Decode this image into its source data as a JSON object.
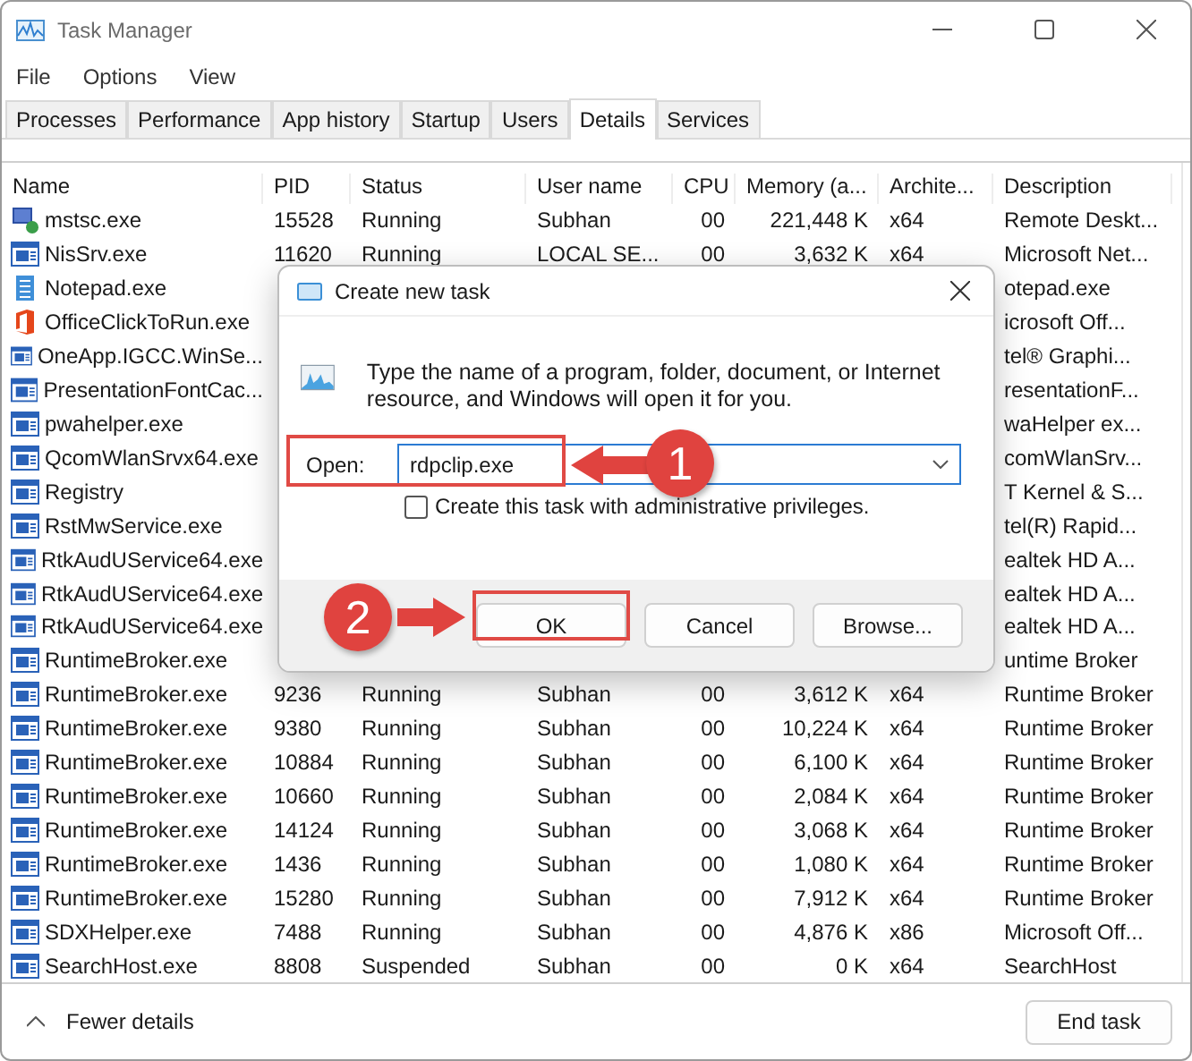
{
  "window": {
    "title": "Task Manager"
  },
  "menu": [
    "File",
    "Options",
    "View"
  ],
  "tabs": [
    {
      "label": "Processes",
      "selected": false
    },
    {
      "label": "Performance",
      "selected": false
    },
    {
      "label": "App history",
      "selected": false
    },
    {
      "label": "Startup",
      "selected": false
    },
    {
      "label": "Users",
      "selected": false
    },
    {
      "label": "Details",
      "selected": true
    },
    {
      "label": "Services",
      "selected": false
    }
  ],
  "table": {
    "columns": [
      "Name",
      "PID",
      "Status",
      "User name",
      "CPU",
      "Memory (a...",
      "Archite...",
      "Description"
    ],
    "rows": [
      {
        "kind": "remote",
        "name": "mstsc.exe",
        "pid": "15528",
        "status": "Running",
        "user": "Subhan",
        "cpu": "00",
        "memory": "221,448 K",
        "arch": "x64",
        "description": "Remote Deskt..."
      },
      {
        "kind": "app",
        "name": "NisSrv.exe",
        "pid": "11620",
        "status": "Running",
        "user": "LOCAL SE...",
        "cpu": "00",
        "memory": "3,632 K",
        "arch": "x64",
        "description": "Microsoft Net..."
      },
      {
        "kind": "notepad",
        "name": "Notepad.exe",
        "description": "otepad.exe"
      },
      {
        "kind": "office",
        "name": "OfficeClickToRun.exe",
        "description": "icrosoft Off..."
      },
      {
        "kind": "app",
        "name": "OneApp.IGCC.WinSe...",
        "description": "tel® Graphi..."
      },
      {
        "kind": "app",
        "name": "PresentationFontCac...",
        "description": "resentationF..."
      },
      {
        "kind": "app",
        "name": "pwahelper.exe",
        "description": "waHelper ex..."
      },
      {
        "kind": "app",
        "name": "QcomWlanSrvx64.exe",
        "description": "comWlanSrv..."
      },
      {
        "kind": "app",
        "name": "Registry",
        "description": "T Kernel & S..."
      },
      {
        "kind": "app",
        "name": "RstMwService.exe",
        "description": "tel(R) Rapid..."
      },
      {
        "kind": "app",
        "name": "RtkAudUService64.exe",
        "description": "ealtek HD A..."
      },
      {
        "kind": "app",
        "name": "RtkAudUService64.exe",
        "description": "ealtek HD A..."
      },
      {
        "kind": "app",
        "name": "RtkAudUService64.exe",
        "description": "ealtek HD A..."
      },
      {
        "kind": "app",
        "name": "RuntimeBroker.exe",
        "description": "untime Broker"
      },
      {
        "kind": "app",
        "name": "RuntimeBroker.exe",
        "pid": "9236",
        "status": "Running",
        "user": "Subhan",
        "cpu": "00",
        "memory": "3,612 K",
        "arch": "x64",
        "description": "Runtime Broker"
      },
      {
        "kind": "app",
        "name": "RuntimeBroker.exe",
        "pid": "9380",
        "status": "Running",
        "user": "Subhan",
        "cpu": "00",
        "memory": "10,224 K",
        "arch": "x64",
        "description": "Runtime Broker"
      },
      {
        "kind": "app",
        "name": "RuntimeBroker.exe",
        "pid": "10884",
        "status": "Running",
        "user": "Subhan",
        "cpu": "00",
        "memory": "6,100 K",
        "arch": "x64",
        "description": "Runtime Broker"
      },
      {
        "kind": "app",
        "name": "RuntimeBroker.exe",
        "pid": "10660",
        "status": "Running",
        "user": "Subhan",
        "cpu": "00",
        "memory": "2,084 K",
        "arch": "x64",
        "description": "Runtime Broker"
      },
      {
        "kind": "app",
        "name": "RuntimeBroker.exe",
        "pid": "14124",
        "status": "Running",
        "user": "Subhan",
        "cpu": "00",
        "memory": "3,068 K",
        "arch": "x64",
        "description": "Runtime Broker"
      },
      {
        "kind": "app",
        "name": "RuntimeBroker.exe",
        "pid": "1436",
        "status": "Running",
        "user": "Subhan",
        "cpu": "00",
        "memory": "1,080 K",
        "arch": "x64",
        "description": "Runtime Broker"
      },
      {
        "kind": "app",
        "name": "RuntimeBroker.exe",
        "pid": "15280",
        "status": "Running",
        "user": "Subhan",
        "cpu": "00",
        "memory": "7,912 K",
        "arch": "x64",
        "description": "Runtime Broker"
      },
      {
        "kind": "app",
        "name": "SDXHelper.exe",
        "pid": "7488",
        "status": "Running",
        "user": "Subhan",
        "cpu": "00",
        "memory": "4,876 K",
        "arch": "x86",
        "description": "Microsoft Off..."
      },
      {
        "kind": "app",
        "name": "SearchHost.exe",
        "pid": "8808",
        "status": "Suspended",
        "user": "Subhan",
        "cpu": "00",
        "memory": "0 K",
        "arch": "x64",
        "description": "SearchHost"
      }
    ]
  },
  "footer": {
    "toggle": "Fewer details",
    "button": "End task"
  },
  "dialog": {
    "title": "Create new task",
    "message": "Type the name of a program, folder, document, or Internet resource, and Windows will open it for you.",
    "open_label": "Open:",
    "open_value": "rdpclip.exe",
    "admin_checkbox": {
      "label": "Create this task with administrative privileges.",
      "checked": false
    },
    "buttons": [
      "OK",
      "Cancel",
      "Browse..."
    ]
  },
  "annotations": [
    {
      "step": "1"
    },
    {
      "step": "2"
    }
  ]
}
